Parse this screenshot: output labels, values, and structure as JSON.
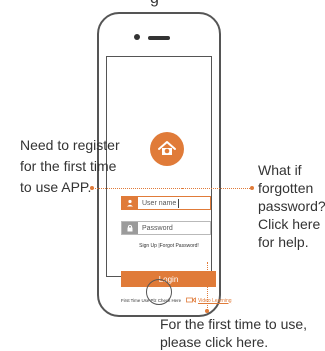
{
  "top_text": "g",
  "phone": {
    "inputs": {
      "username_placeholder": "User name",
      "password_placeholder": "Password"
    },
    "links_text": "Sign Up   |Forgot Password!",
    "login_label": "Login",
    "first_time_text": "First Time Use Plz Check Here",
    "video_label": "Video Learning"
  },
  "annotations": {
    "left": "Need to register for the first time to use APP.",
    "right": "What if forgotten password? Click here for help.",
    "bottom": "For the first time to use, please click here."
  },
  "colors": {
    "accent": "#e07b39",
    "outline": "#555555"
  },
  "icons": {
    "logo": "house-cloud-icon",
    "user": "user-icon",
    "password": "lock-icon",
    "video": "video-camera-icon"
  }
}
